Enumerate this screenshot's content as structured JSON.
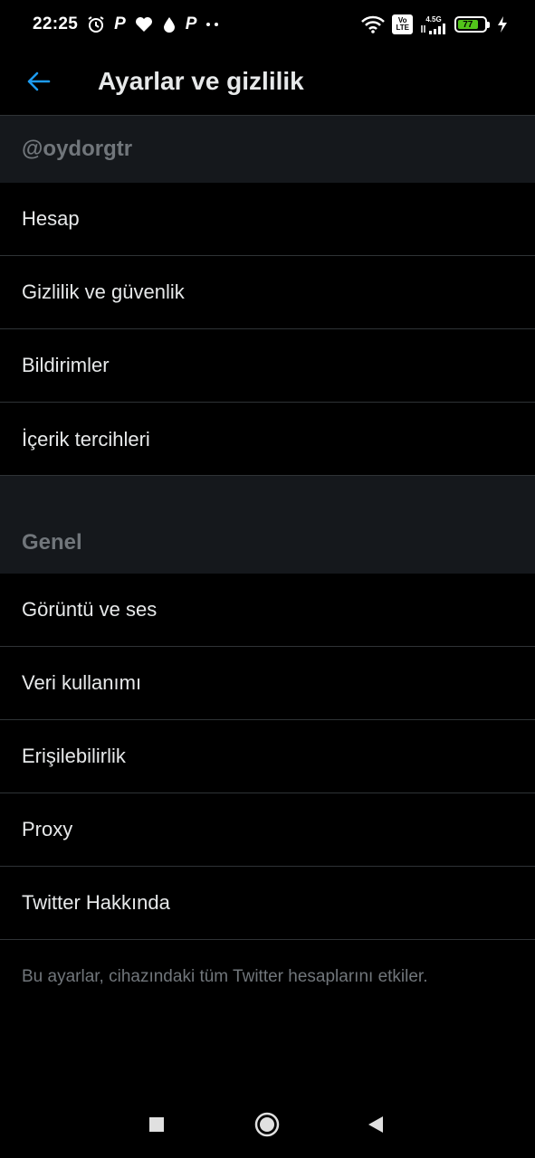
{
  "status_bar": {
    "time": "22:25",
    "notification_letters": [
      "P",
      "P"
    ],
    "volte_label": "Vo\nLTE",
    "network_label": "4.5G",
    "battery_level": "77",
    "battery_color": "#52c41a"
  },
  "header": {
    "title": "Ayarlar ve gizlilik",
    "back_icon": "arrow-left-icon",
    "accent_color": "#1d9bf0"
  },
  "account_section": {
    "heading": "@oydorgtr",
    "items": [
      {
        "label": "Hesap"
      },
      {
        "label": "Gizlilik ve güvenlik"
      },
      {
        "label": "Bildirimler"
      },
      {
        "label": "İçerik tercihleri"
      }
    ]
  },
  "general_section": {
    "heading": "Genel",
    "items": [
      {
        "label": "Görüntü ve ses"
      },
      {
        "label": "Veri kullanımı"
      },
      {
        "label": "Erişilebilirlik"
      },
      {
        "label": "Proxy"
      },
      {
        "label": "Twitter Hakkında"
      }
    ]
  },
  "footer_note": "Bu ayarlar, cihazındaki tüm Twitter hesaplarını etkiler.",
  "nav_bar": {
    "icons": [
      "recents-square-icon",
      "home-circle-icon",
      "back-triangle-icon"
    ]
  }
}
